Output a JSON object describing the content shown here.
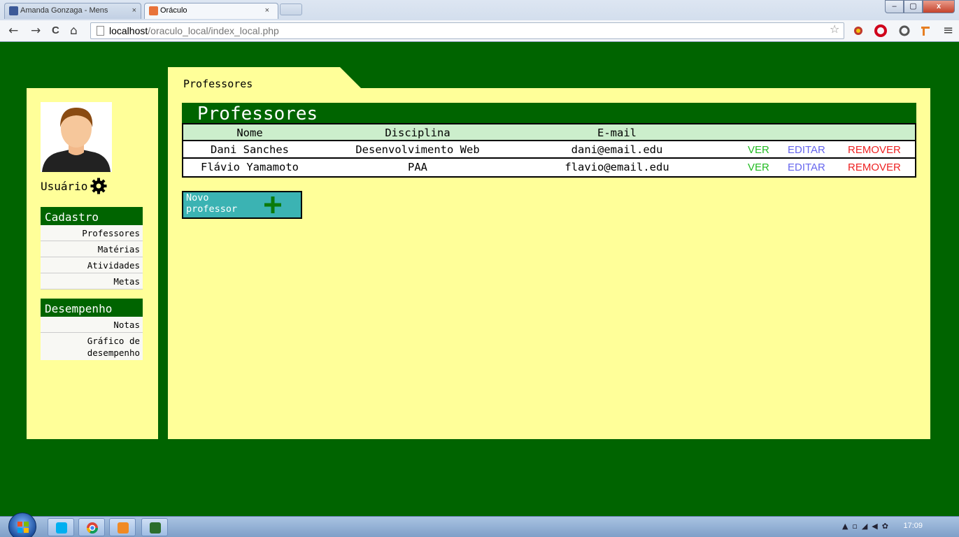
{
  "browser": {
    "tabs": [
      {
        "label": "Amanda Gonzaga - Mens",
        "close": "×",
        "active": false
      },
      {
        "label": "Oráculo",
        "close": "×",
        "active": true
      }
    ],
    "url_host": "localhost",
    "url_path": "/oraculo_local/index_local.php",
    "window_controls": {
      "minimize": "–",
      "maximize": "▢",
      "close": "x"
    },
    "nav": {
      "back": "←",
      "forward": "→",
      "reload": "C",
      "home": "⌂",
      "menu": "≡",
      "star": "☆"
    }
  },
  "sidebar": {
    "user_label": "Usuário",
    "sections": [
      {
        "title": "Cadastro",
        "items": [
          "Professores",
          "Matérias",
          "Atividades",
          "Metas"
        ]
      },
      {
        "title": "Desempenho",
        "items": [
          "Notas",
          "Gráfico de desempenho"
        ]
      }
    ]
  },
  "main": {
    "tab_label": "Professores",
    "title": "Professores",
    "table": {
      "headers": {
        "nome": "Nome",
        "disciplina": "Disciplina",
        "email": "E-mail"
      },
      "rows": [
        {
          "nome": "Dani Sanches",
          "disciplina": "Desenvolvimento Web",
          "email": "dani@email.edu"
        },
        {
          "nome": "Flávio Yamamoto",
          "disciplina": "PAA",
          "email": "flavio@email.edu"
        }
      ],
      "actions": {
        "view": "VER",
        "edit": "EDITAR",
        "remove": "REMOVER"
      }
    },
    "new_button": {
      "line1": "Novo",
      "line2": "professor"
    }
  },
  "taskbar": {
    "clock": "17:09"
  },
  "colors": {
    "page_bg": "#006400",
    "panel_bg": "#ffff99",
    "header_row": "#cceecc",
    "action_view": "#22bb22",
    "action_edit": "#6666ee",
    "action_remove": "#ee2222",
    "new_button_bg": "#3bb3b3"
  }
}
